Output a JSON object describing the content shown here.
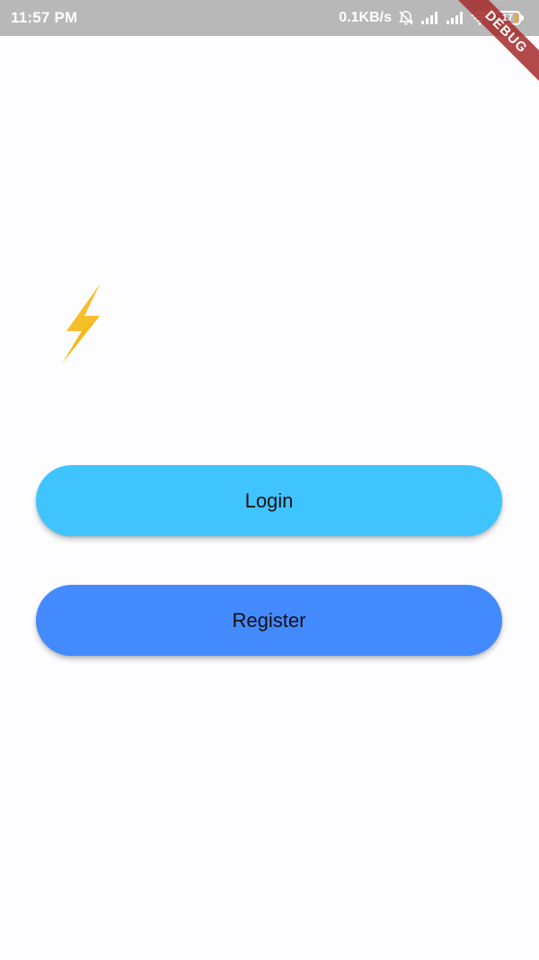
{
  "status_bar": {
    "time": "11:57 PM",
    "net_speed": "0.1KB/s",
    "battery_level": "17",
    "icons": [
      "alarm-off-icon",
      "signal-icon",
      "signal-icon",
      "wifi-icon",
      "battery-icon"
    ]
  },
  "debug_banner": {
    "label": "DEBUG",
    "color": "#a52a2a"
  },
  "logo": {
    "icon": "lightning-bolt-icon",
    "color": "#f5b719"
  },
  "buttons": {
    "login_label": "Login",
    "login_color": "#40c4ff",
    "register_label": "Register",
    "register_color": "#448aff"
  }
}
